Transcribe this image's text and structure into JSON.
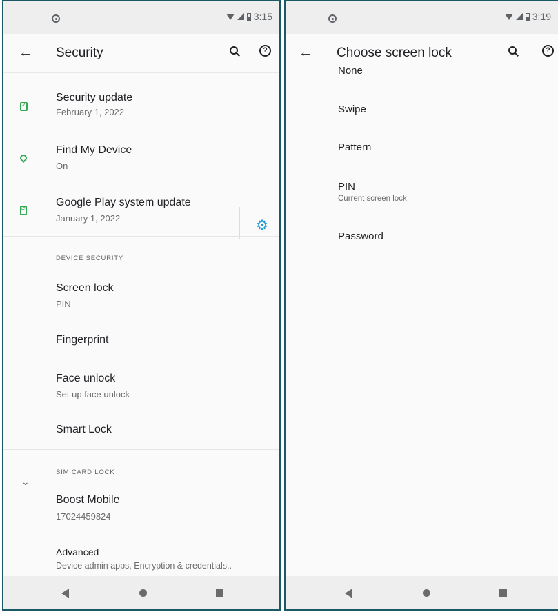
{
  "left": {
    "status": {
      "time": "3:15"
    },
    "appbar": {
      "title": "Security"
    },
    "items": {
      "security_update": {
        "title": "Security update",
        "subtitle": "February 1, 2022"
      },
      "find_my_device": {
        "title": "Find My Device",
        "subtitle": "On"
      },
      "play_update": {
        "title": "Google Play system update",
        "subtitle": "January 1, 2022"
      }
    },
    "device_security": {
      "header": "DEVICE SECURITY",
      "screen_lock": {
        "title": "Screen lock",
        "subtitle": "PIN"
      },
      "fingerprint": {
        "title": "Fingerprint"
      },
      "face_unlock": {
        "title": "Face unlock",
        "subtitle": "Set up face unlock"
      },
      "smart_lock": {
        "title": "Smart Lock"
      }
    },
    "sim_card_lock": {
      "header": "SIM CARD LOCK",
      "boost": {
        "title": "Boost Mobile",
        "subtitle": "17024459824"
      }
    },
    "advanced": {
      "title": "Advanced",
      "subtitle": "Device admin apps, Encryption & credentials.."
    }
  },
  "right": {
    "status": {
      "time": "3:19"
    },
    "appbar": {
      "title": "Choose screen lock"
    },
    "options": [
      {
        "title": "None"
      },
      {
        "title": "Swipe"
      },
      {
        "title": "Pattern"
      },
      {
        "title": "PIN",
        "subtitle": "Current screen lock"
      },
      {
        "title": "Password"
      }
    ]
  },
  "icons": {
    "back": "arrow-back-icon",
    "search": "search-icon",
    "help": "help-icon",
    "settings": "gear-icon",
    "expand": "chevron-down-icon"
  },
  "colors": {
    "accent_green": "#34a853",
    "accent_blue": "#1a9ad6",
    "frame": "#1a5a66"
  }
}
